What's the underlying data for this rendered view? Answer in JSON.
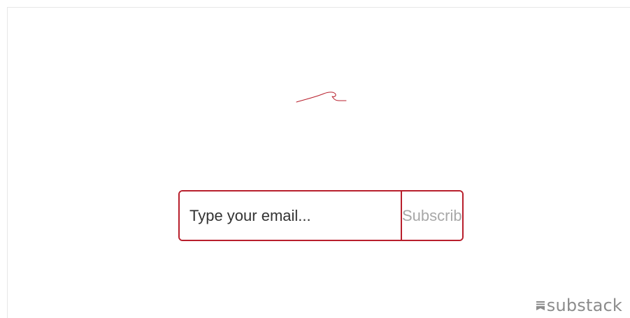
{
  "embed": {
    "email_placeholder": "Type your email...",
    "subscribe_label": "Subscribe"
  },
  "brand": {
    "name": "substack",
    "icon": "substack-logo-icon"
  },
  "icons": {
    "header": "wave-logo-icon"
  },
  "colors": {
    "accent": "#b81f2c",
    "button_text": "#a8a8a8",
    "brand_text": "#8c8c8c",
    "background": "#ffffff"
  }
}
